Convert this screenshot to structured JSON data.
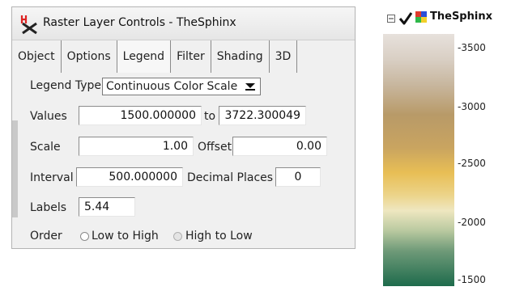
{
  "dialog": {
    "title": "Raster Layer Controls - TheSphinx",
    "tabs": [
      "Object",
      "Options",
      "Legend",
      "Filter",
      "Shading",
      "3D"
    ],
    "active_tab": "Legend",
    "legend_type_label": "Legend Type",
    "legend_type_value": "Continuous Color Scale",
    "values_label": "Values",
    "values_from": "1500.000000",
    "to_label": "to",
    "values_to": "3722.300049",
    "scale_label": "Scale",
    "scale_value": "1.00",
    "offset_label": "Offset",
    "offset_value": "0.00",
    "interval_label": "Interval",
    "interval_value": "500.000000",
    "decimal_places_label": "Decimal Places",
    "decimal_places_value": "0",
    "labels_label": "Labels",
    "labels_value": "5.44",
    "order_label": "Order",
    "order_low_to_high": "Low to High",
    "order_high_to_low": "High to Low"
  },
  "layer_panel": {
    "layer_name": "TheSphinx",
    "checked": true,
    "expander": "⊟",
    "ticks": [
      "-3500",
      "-3000",
      "-2500",
      "-2000",
      "-1500"
    ]
  },
  "colors": {
    "ramp_top": "#e7e1dc",
    "ramp_mid_tan": "#b89a68",
    "ramp_gold": "#e8be55",
    "ramp_pale": "#efe7c0",
    "ramp_green": "#1e6b4c"
  }
}
